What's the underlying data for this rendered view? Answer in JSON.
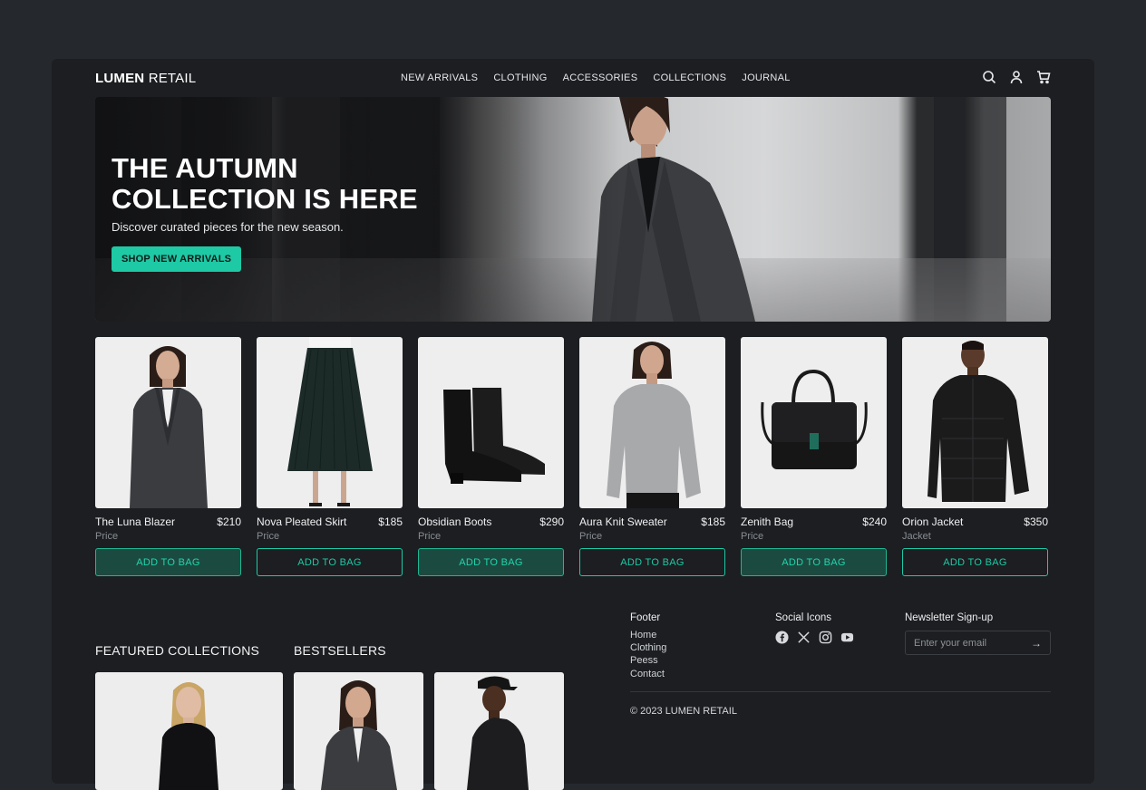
{
  "brand": {
    "bold": "LUMEN",
    "light": " RETAIL"
  },
  "nav": [
    "NEW ARRIVALS",
    "CLOTHING",
    "ACCESSORIES",
    "COLLECTIONS",
    "JOURNAL"
  ],
  "header_icons": [
    "search-icon",
    "user-icon",
    "cart-icon"
  ],
  "hero": {
    "title": "THE AUTUMN\nCOLLECTION IS HERE",
    "subtitle": "Discover curated pieces for the new season.",
    "cta": "SHOP NEW ARRIVALS"
  },
  "products": [
    {
      "name": "The Luna Blazer",
      "price": "$210",
      "sub": "Price",
      "button": "ADD TO BAG",
      "style": "filled"
    },
    {
      "name": "Nova Pleated Skirt",
      "price": "$185",
      "sub": "Price",
      "button": "ADD TO BAG",
      "style": "outline"
    },
    {
      "name": "Obsidian Boots",
      "price": "$290",
      "sub": "Price",
      "button": "ADD TO BAG",
      "style": "filled"
    },
    {
      "name": "Aura Knit Sweater",
      "price": "$185",
      "sub": "Price",
      "button": "ADD TO BAG",
      "style": "outline"
    },
    {
      "name": "Zenith Bag",
      "price": "$240",
      "sub": "Price",
      "button": "ADD TO BAG",
      "style": "filled"
    },
    {
      "name": "Orion Jacket",
      "price": "$350",
      "sub": "Jacket",
      "button": "ADD TO BAG",
      "style": "outline"
    }
  ],
  "sections": {
    "featured": "FEATURED COLLECTIONS",
    "bestsellers": "BESTSELLERS"
  },
  "footer": {
    "heading": "Footer",
    "links": [
      "Home",
      "Clothing",
      "Peess",
      "Contact"
    ],
    "social_heading": "Social Icons",
    "social": [
      "facebook-icon",
      "x-icon",
      "instagram-icon",
      "youtube-icon"
    ],
    "newsletter_heading": "Newsletter Sign-up",
    "email_placeholder": "Enter your email",
    "copyright": "© 2023 LUMEN RETAIL"
  },
  "colors": {
    "accent": "#1ec9a5",
    "page_bg": "#25282c",
    "panel_bg": "#1c1e21"
  }
}
